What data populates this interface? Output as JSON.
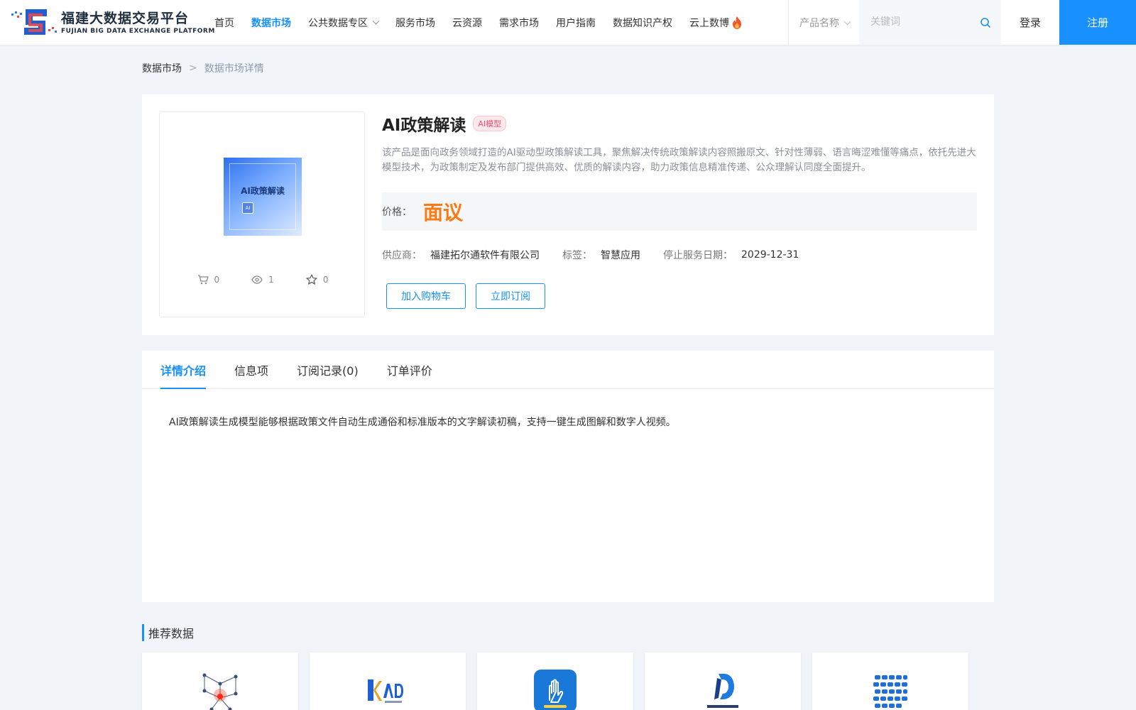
{
  "header": {
    "logo_cn": "福建大数据交易平台",
    "logo_en": "FUJIAN BIG DATA EXCHANGE  PLATFORM",
    "nav": [
      {
        "label": "首页"
      },
      {
        "label": "数据市场"
      },
      {
        "label": "公共数据专区"
      },
      {
        "label": "服务市场"
      },
      {
        "label": "云资源"
      },
      {
        "label": "需求市场"
      },
      {
        "label": "用户指南"
      },
      {
        "label": "数据知识产权"
      },
      {
        "label": "云上数博"
      }
    ],
    "active_nav": "数据市场",
    "search_select": "产品名称",
    "search_placeholder": "关键词",
    "login": "登录",
    "register": "注册"
  },
  "breadcrumb": {
    "root": "数据市场",
    "separator": ">",
    "current": "数据市场详情"
  },
  "product": {
    "cover_title": "AI政策解读",
    "cover_chip": "AI",
    "stats": {
      "cart_count": "0",
      "view_count": "1",
      "favorite_count": "0"
    },
    "title": "AI政策解读",
    "badge": "AI模型",
    "description": "该产品是面向政务领域打造的AI驱动型政策解读工具，聚焦解决传统政策解读内容照搬原文、针对性薄弱、语言晦涩难懂等痛点，依托先进大模型技术，为政策制定及发布部门提供高效、优质的解读内容，助力政策信息精准传递、公众理解认同度全面提升。",
    "price_label": "价格：",
    "price_value": "面议",
    "supplier_label": "供应商：",
    "supplier": "福建拓尔通软件有限公司",
    "tag_label": "标签：",
    "tag": "智慧应用",
    "end_date_label": "停止服务日期：",
    "end_date": "2029-12-31",
    "add_to_cart": "加入购物车",
    "subscribe": "立即订阅"
  },
  "tabs": {
    "items": [
      {
        "label": "详情介绍"
      },
      {
        "label": "信息项"
      },
      {
        "label": "订阅记录(0)"
      },
      {
        "label": "订单评价"
      }
    ],
    "active": "详情介绍",
    "content": "AI政策解读生成模型能够根据政策文件自动生成通俗和标准版本的文字解读初稿，支持一键生成图解和数字人视频。"
  },
  "recommended": {
    "title": "推荐数据",
    "items": [
      {
        "icon": "network-graph-icon"
      },
      {
        "icon": "adcid-logo-icon"
      },
      {
        "icon": "hand-gesture-app-icon"
      },
      {
        "icon": "data-d-logo-icon"
      },
      {
        "icon": "blue-dots-grid-icon"
      }
    ]
  },
  "colors": {
    "primary": "#1890ff",
    "price": "#fa7a14",
    "badge": "#f0506e",
    "background": "#f1f5f9"
  }
}
